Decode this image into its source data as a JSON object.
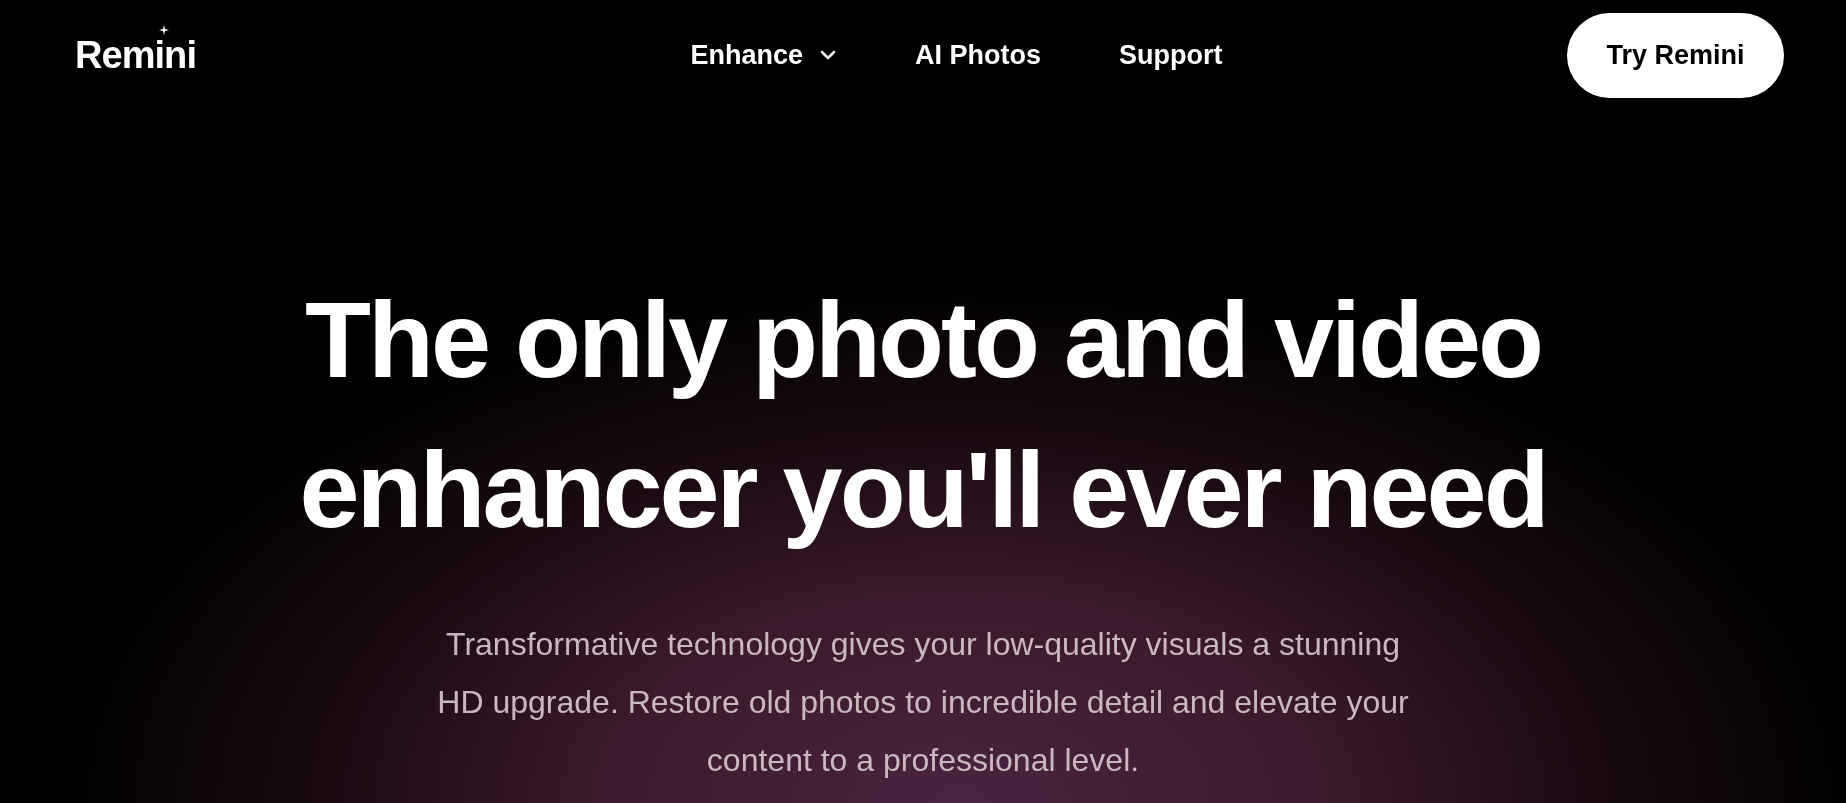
{
  "header": {
    "logo": "Remini",
    "nav": [
      {
        "label": "Enhance",
        "kind": "dropdown"
      },
      {
        "label": "AI Photos",
        "kind": "link"
      },
      {
        "label": "Support",
        "kind": "link"
      }
    ],
    "cta": "Try Remini"
  },
  "hero": {
    "headline_lines": [
      "The only photo and video",
      "enhancer you'll ever need"
    ],
    "description": "Transformative technology gives your low-quality visuals a stunning HD upgrade. Restore old photos to incredible detail and elevate your content to a professional level."
  }
}
